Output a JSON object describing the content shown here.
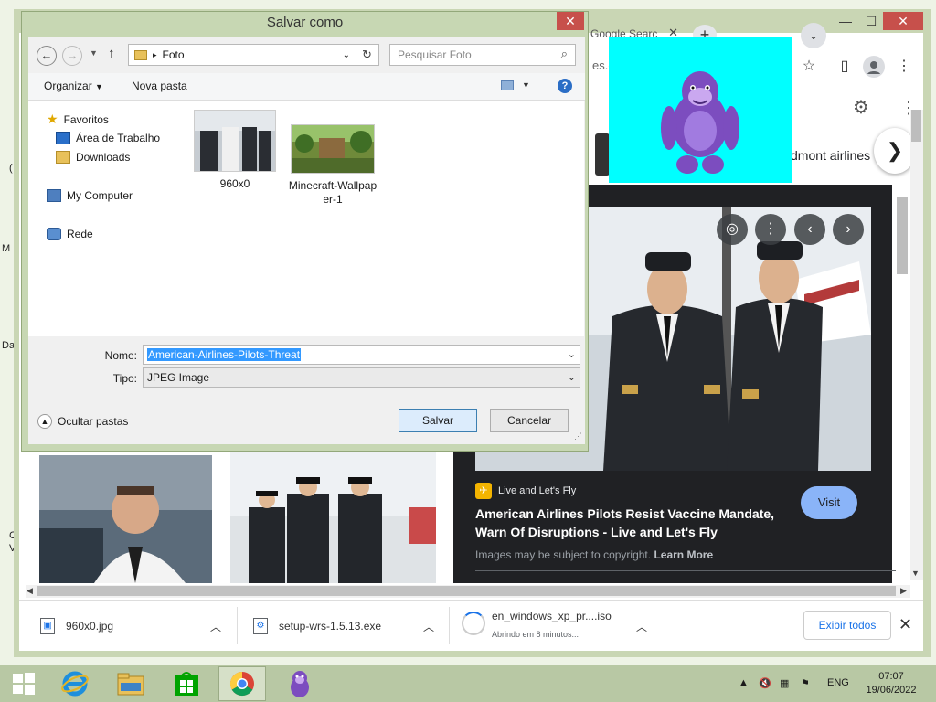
{
  "desktop": {
    "fragments": [
      "(",
      "M",
      "Da",
      "C",
      "V"
    ]
  },
  "chrome": {
    "tab_title": "Google Searc",
    "address_fragment": "es.g",
    "piedmont_text": "dmont airlines",
    "result": {
      "source": "Live and Let's Fly",
      "title": "American Airlines Pilots Resist Vaccine Mandate, Warn Of Disruptions - Live and Let's Fly",
      "visit_label": "Visit",
      "copyright_text": "Images may be subject to copyright.",
      "learn_more": "Learn More"
    },
    "downloads": [
      {
        "name": "960x0.jpg",
        "status": ""
      },
      {
        "name": "setup-wrs-1.5.13.exe",
        "status": ""
      },
      {
        "name": "en_windows_xp_pr....iso",
        "status": "Abrindo em 8 minutos..."
      }
    ],
    "show_all_label": "Exibir todos"
  },
  "dialog": {
    "title": "Salvar como",
    "path": "Foto",
    "search_placeholder": "Pesquisar Foto",
    "organize_label": "Organizar",
    "new_folder_label": "Nova pasta",
    "nav": {
      "favorites": "Favoritos",
      "desktop": "Área de Trabalho",
      "downloads": "Downloads",
      "computer": "My Computer",
      "network": "Rede"
    },
    "files": [
      {
        "name": "960x0"
      },
      {
        "name": "Minecraft-Wallpaper-1"
      }
    ],
    "name_label": "Nome:",
    "name_value": "American-Airlines-Pilots-Threat",
    "type_label": "Tipo:",
    "type_value": "JPEG Image",
    "hide_folders_label": "Ocultar pastas",
    "save_label": "Salvar",
    "cancel_label": "Cancelar"
  },
  "taskbar": {
    "language": "ENG",
    "time": "07:07",
    "date": "19/06/2022"
  }
}
